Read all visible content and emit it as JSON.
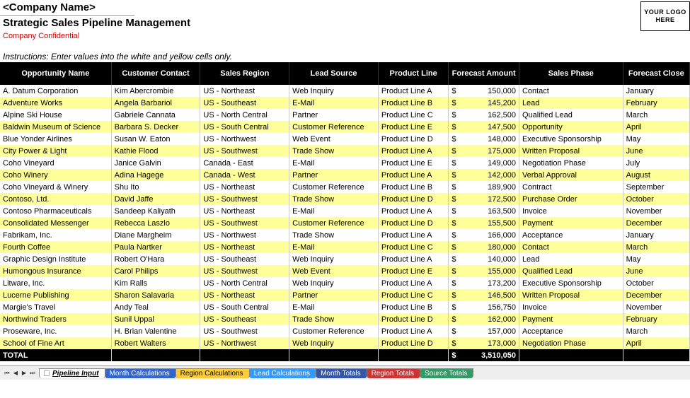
{
  "header": {
    "company_name": "<Company Name>",
    "title": "Strategic Sales Pipeline Management",
    "confidential": "Company Confidential",
    "logo_text": "YOUR LOGO HERE"
  },
  "instructions": "Instructions: Enter values into the white and yellow cells only.",
  "columns": [
    "Opportunity Name",
    "Customer Contact",
    "Sales Region",
    "Lead Source",
    "Product Line",
    "Forecast Amount",
    "Sales Phase",
    "Forecast Close"
  ],
  "rows": [
    {
      "name": "A. Datum Corporation",
      "contact": "Kim Abercrombie",
      "region": "US - Northeast",
      "lead": "Web Inquiry",
      "product": "Product Line A",
      "amount": "150,000",
      "phase": "Contact",
      "close": "January"
    },
    {
      "name": "Adventure Works",
      "contact": "Angela Barbariol",
      "region": "US - Southeast",
      "lead": "E-Mail",
      "product": "Product Line B",
      "amount": "145,200",
      "phase": "Lead",
      "close": "February"
    },
    {
      "name": "Alpine Ski House",
      "contact": "Gabriele Cannata",
      "region": "US - North Central",
      "lead": "Partner",
      "product": "Product Line C",
      "amount": "162,500",
      "phase": "Qualified Lead",
      "close": "March"
    },
    {
      "name": "Baldwin Museum of Science",
      "contact": "Barbara S. Decker",
      "region": "US - South Central",
      "lead": "Customer Reference",
      "product": "Product Line E",
      "amount": "147,500",
      "phase": "Opportunity",
      "close": "April"
    },
    {
      "name": "Blue Yonder Airlines",
      "contact": "Susan W. Eaton",
      "region": "US - Northwest",
      "lead": "Web Event",
      "product": "Product Line D",
      "amount": "148,000",
      "phase": "Executive Sponsorship",
      "close": "May"
    },
    {
      "name": "City Power & Light",
      "contact": "Kathie Flood",
      "region": "US - Southwest",
      "lead": "Trade Show",
      "product": "Product Line A",
      "amount": "175,000",
      "phase": "Written Proposal",
      "close": "June"
    },
    {
      "name": "Coho Vineyard",
      "contact": "Janice Galvin",
      "region": "Canada - East",
      "lead": "E-Mail",
      "product": "Product Line E",
      "amount": "149,000",
      "phase": "Negotiation Phase",
      "close": "July"
    },
    {
      "name": "Coho Winery",
      "contact": "Adina Hagege",
      "region": "Canada - West",
      "lead": "Partner",
      "product": "Product Line A",
      "amount": "142,000",
      "phase": "Verbal Approval",
      "close": "August"
    },
    {
      "name": "Coho Vineyard & Winery",
      "contact": "Shu Ito",
      "region": "US - Northeast",
      "lead": "Customer Reference",
      "product": "Product Line B",
      "amount": "189,900",
      "phase": "Contract",
      "close": "September"
    },
    {
      "name": "Contoso, Ltd.",
      "contact": "David Jaffe",
      "region": "US - Southwest",
      "lead": "Trade Show",
      "product": "Product Line D",
      "amount": "172,500",
      "phase": "Purchase Order",
      "close": "October"
    },
    {
      "name": "Contoso Pharmaceuticals",
      "contact": "Sandeep Kaliyath",
      "region": "US - Northeast",
      "lead": "E-Mail",
      "product": "Product Line A",
      "amount": "163,500",
      "phase": "Invoice",
      "close": "November"
    },
    {
      "name": "Consolidated Messenger",
      "contact": "Rebecca Laszlo",
      "region": "US - Southwest",
      "lead": "Customer Reference",
      "product": "Product Line D",
      "amount": "155,500",
      "phase": "Payment",
      "close": "December"
    },
    {
      "name": "Fabrikam, Inc.",
      "contact": "Diane Margheim",
      "region": "US - Northwest",
      "lead": "Trade Show",
      "product": "Product Line A",
      "amount": "166,000",
      "phase": "Acceptance",
      "close": "January"
    },
    {
      "name": "Fourth Coffee",
      "contact": "Paula Nartker",
      "region": "US - Northeast",
      "lead": "E-Mail",
      "product": "Product Line C",
      "amount": "180,000",
      "phase": "Contact",
      "close": "March"
    },
    {
      "name": "Graphic Design Institute",
      "contact": "Robert O'Hara",
      "region": "US - Southeast",
      "lead": "Web Inquiry",
      "product": "Product Line A",
      "amount": "140,000",
      "phase": "Lead",
      "close": "May"
    },
    {
      "name": "Humongous Insurance",
      "contact": "Carol Philips",
      "region": "US - Southwest",
      "lead": "Web Event",
      "product": "Product Line E",
      "amount": "155,000",
      "phase": "Qualified Lead",
      "close": "June"
    },
    {
      "name": "Litware, Inc.",
      "contact": "Kim Ralls",
      "region": "US - North Central",
      "lead": "Web Inquiry",
      "product": "Product Line A",
      "amount": "173,200",
      "phase": "Executive Sponsorship",
      "close": "October"
    },
    {
      "name": "Lucerne Publishing",
      "contact": "Sharon Salavaria",
      "region": "US - Northeast",
      "lead": "Partner",
      "product": "Product Line C",
      "amount": "146,500",
      "phase": "Written Proposal",
      "close": "December"
    },
    {
      "name": "Margie's Travel",
      "contact": "Andy Teal",
      "region": "US - South Central",
      "lead": "E-Mail",
      "product": "Product Line B",
      "amount": "156,750",
      "phase": "Invoice",
      "close": "November"
    },
    {
      "name": "Northwind Traders",
      "contact": "Sunil Uppal",
      "region": "US - Southeast",
      "lead": "Trade Show",
      "product": "Product Line D",
      "amount": "162,000",
      "phase": "Payment",
      "close": "February"
    },
    {
      "name": "Proseware, Inc.",
      "contact": "H. Brian Valentine",
      "region": "US - Southwest",
      "lead": "Customer Reference",
      "product": "Product Line A",
      "amount": "157,000",
      "phase": "Acceptance",
      "close": "March"
    },
    {
      "name": "School of Fine Art",
      "contact": "Robert Walters",
      "region": "US - Northwest",
      "lead": "Web Inquiry",
      "product": "Product Line D",
      "amount": "173,000",
      "phase": "Negotiation Phase",
      "close": "April"
    }
  ],
  "total": {
    "label": "TOTAL",
    "amount": "3,510,050"
  },
  "tabs": [
    {
      "label": "Pipeline Input",
      "color": "#ffffff",
      "active": true
    },
    {
      "label": "Month Calculations",
      "color": "#3366cc",
      "active": false
    },
    {
      "label": "Region Calculations",
      "color": "#ffcc33",
      "active": false
    },
    {
      "label": "Lead Calculations",
      "color": "#3399ff",
      "active": false
    },
    {
      "label": "Month Totals",
      "color": "#3355aa",
      "active": false
    },
    {
      "label": "Region Totals",
      "color": "#cc3333",
      "active": false
    },
    {
      "label": "Source Totals",
      "color": "#339966",
      "active": false
    }
  ]
}
